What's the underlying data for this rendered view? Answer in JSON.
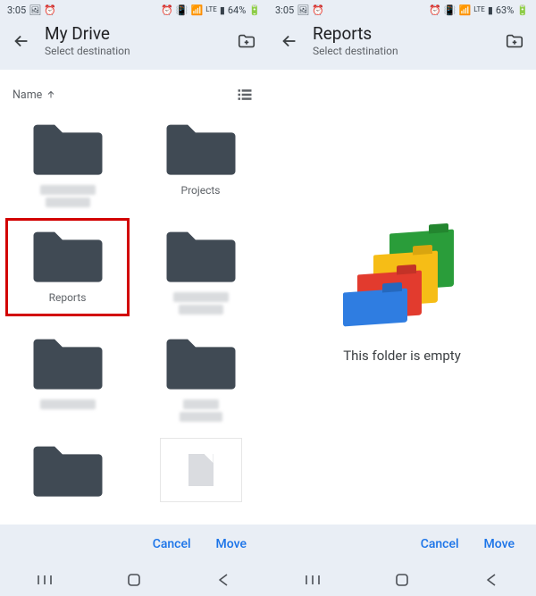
{
  "left": {
    "status": {
      "time": "3:05",
      "battery": "64%"
    },
    "title": "My Drive",
    "subtitle": "Select destination",
    "sort_label": "Name",
    "items": [
      {
        "label": "",
        "kind": "folder",
        "blurred": true
      },
      {
        "label": "Projects",
        "kind": "folder",
        "blurred": false
      },
      {
        "label": "Reports",
        "kind": "folder",
        "blurred": false,
        "highlighted": true
      },
      {
        "label": "",
        "kind": "folder",
        "blurred": true
      },
      {
        "label": "",
        "kind": "folder",
        "blurred": true
      },
      {
        "label": "",
        "kind": "folder",
        "blurred": true
      },
      {
        "label": "",
        "kind": "folder",
        "blurred": false
      },
      {
        "label": "",
        "kind": "file",
        "blurred": false
      }
    ],
    "actions": {
      "cancel": "Cancel",
      "move": "Move"
    }
  },
  "right": {
    "status": {
      "time": "3:05",
      "battery": "63%"
    },
    "title": "Reports",
    "subtitle": "Select destination",
    "empty_message": "This folder is empty",
    "actions": {
      "cancel": "Cancel",
      "move": "Move"
    }
  }
}
